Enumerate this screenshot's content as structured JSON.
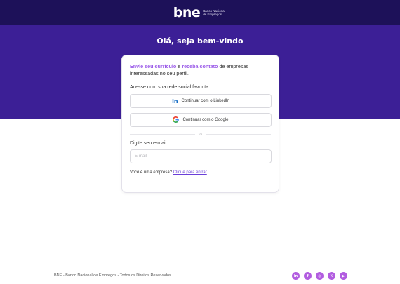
{
  "header": {
    "logo_mark": "bne",
    "logo_sub": "Banco Nacional de Empregos"
  },
  "hero": {
    "title": "Olá, seja bem-vindo"
  },
  "card": {
    "intro_part1": "Envie seu currículo",
    "intro_part2": " e ",
    "intro_part3": "receba contato",
    "intro_part4": " de empresas interessadas no seu perfil.",
    "social_label": "Acesse com sua rede social favorita:",
    "linkedin_icon": "in",
    "linkedin_label": "Continuar com o LinkedIn",
    "google_label": "Continuar com o Google",
    "divider_text": "ou",
    "email_label": "Digite seu e-mail:",
    "email_placeholder": "E-mail",
    "email_value": "",
    "company_question": "Você é uma empresa?",
    "company_link": "Clique para entrar"
  },
  "footer": {
    "copyright": "BNE - Banco Nacional de Empregos - Todos os Direitos Reservados",
    "social_icons": [
      {
        "name": "linkedin-icon",
        "glyph": "in"
      },
      {
        "name": "facebook-icon",
        "glyph": "f"
      },
      {
        "name": "instagram-icon",
        "glyph": "◎"
      },
      {
        "name": "x-icon",
        "glyph": "𝕏"
      },
      {
        "name": "youtube-icon",
        "glyph": "▶"
      }
    ]
  },
  "colors": {
    "topbar": "#1d1159",
    "hero": "#3c1f96",
    "highlight": "#9a5ae8",
    "link": "#6a3fd8",
    "social_icon_bg": "#b25de0"
  }
}
